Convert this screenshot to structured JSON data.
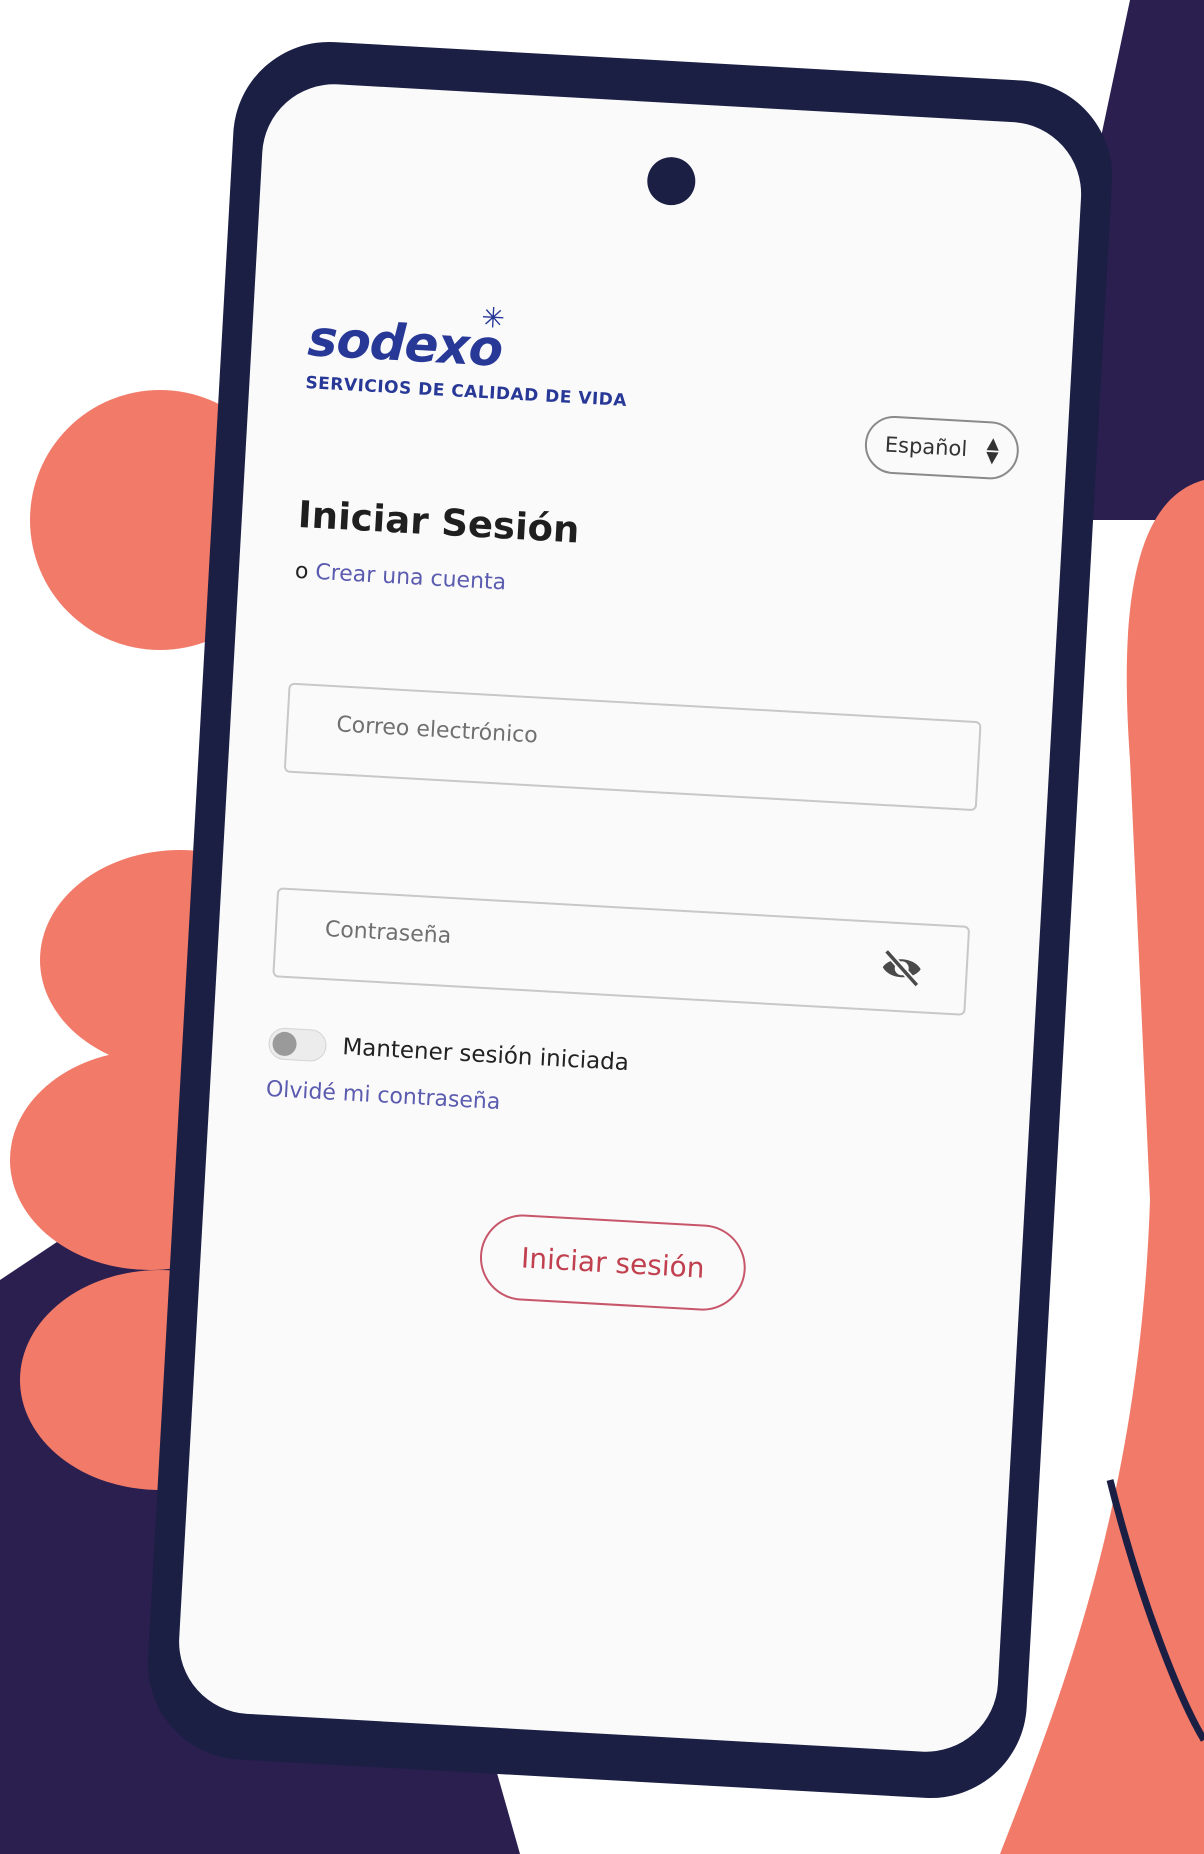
{
  "brand": {
    "name": "sodexo",
    "tagline": "SERVICIOS DE CALIDAD DE VIDA",
    "color": "#283897"
  },
  "language_select": {
    "selected": "Español"
  },
  "login": {
    "title": "Iniciar Sesión",
    "or_prefix": "o",
    "create_account": "Crear una cuenta",
    "email_placeholder": "Correo electrónico",
    "password_placeholder": "Contraseña",
    "remember_label": "Mantener sesión iniciada",
    "remember_on": false,
    "forgot_password": "Olvidé mi contraseña",
    "submit_label": "Iniciar sesión"
  },
  "icons": {
    "password_toggle": "eye-off-icon",
    "select_arrows": "sort-icon"
  },
  "colors": {
    "background_dark": "#2a1f4f",
    "hand": "#f17a68",
    "phone_frame": "#1b1f44",
    "link": "#5b5bb0",
    "submit_text": "#c0404f",
    "submit_border": "#c8566a"
  }
}
